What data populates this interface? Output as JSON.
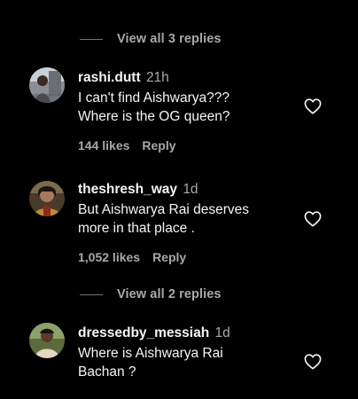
{
  "colors": {
    "background": "#000000",
    "primary_text": "#f5f5f5",
    "secondary_text": "#a8a8a8",
    "divider": "#737373"
  },
  "replies_top": {
    "label": "View all 3 replies"
  },
  "comments": [
    {
      "username": "rashi.dutt",
      "time": "21h",
      "line1": "I can't find Aishwarya???",
      "line2": "Where is the OG queen?",
      "likes": "144 likes",
      "reply_label": "Reply",
      "like_icon": "heart-outline-icon"
    },
    {
      "username": "theshresh_way",
      "time": "1d",
      "line1": "But Aishwarya Rai deserves",
      "line2": "more in that place .",
      "likes": "1,052 likes",
      "reply_label": "Reply",
      "like_icon": "heart-outline-icon"
    },
    {
      "username": "dressedby_messiah",
      "time": "1d",
      "line1": "Where is Aishwarya Rai",
      "line2": "Bachan ?",
      "like_icon": "heart-outline-icon"
    }
  ],
  "replies_mid": {
    "label": "View all 2 replies"
  }
}
